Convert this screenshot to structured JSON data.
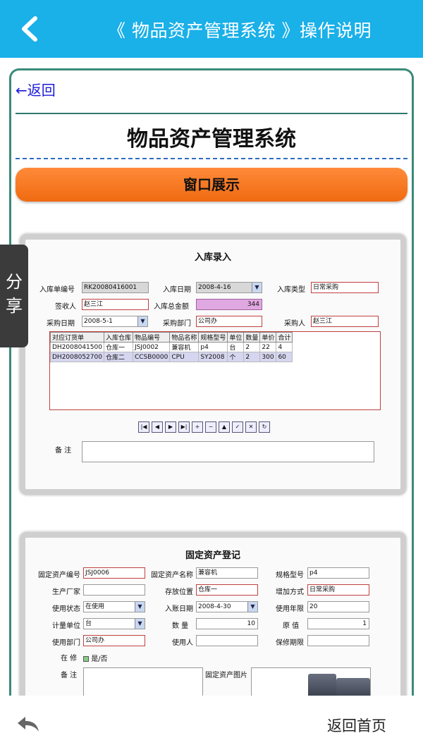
{
  "header": {
    "title": "《 物品资产管理系统 》操作说明"
  },
  "page": {
    "back_link": "←返回",
    "title": "物品资产管理系统",
    "section_banner": "窗口展示"
  },
  "share": {
    "label": "分享"
  },
  "window1": {
    "title": "入库录入",
    "fields": {
      "receipt_no_label": "入库单编号",
      "receipt_no": "RK20080416001",
      "date_label": "入库日期",
      "date": "2008-4-16",
      "type_label": "入库类型",
      "type": "日常采购",
      "receiver_label": "签收人",
      "receiver": "赵三江",
      "total_label": "入库总金额",
      "total": "344",
      "purchase_date_label": "采购日期",
      "purchase_date": "2008-5-1",
      "dept_label": "采购部门",
      "dept": "公司办",
      "buyer_label": "采购人",
      "buyer": "赵三江"
    },
    "grid": {
      "columns": [
        "对应订货单",
        "入库仓库",
        "物品编号",
        "物品名称",
        "规格型号",
        "单位",
        "数量",
        "单价",
        "合计"
      ],
      "rows": [
        [
          "DH2008041500",
          "仓库一",
          "JSJ0002",
          "兼容机",
          "p4",
          "台",
          "2",
          "22",
          "4"
        ],
        [
          "DH2008052700",
          "仓库二",
          "CCSB0000",
          "CPU",
          "SY2008",
          "个",
          "2",
          "300",
          "60"
        ]
      ]
    },
    "memo_label": "备  注"
  },
  "window2": {
    "title": "固定资产登记",
    "fields": {
      "asset_no_label": "固定资产编号",
      "asset_no": "JSJ0006",
      "asset_name_label": "固定资产名称",
      "asset_name": "兼容机",
      "spec_label": "规格型号",
      "spec": "p4",
      "maker_label": "生产厂家",
      "maker": "",
      "location_label": "存放位置",
      "location": "仓库一",
      "add_method_label": "增加方式",
      "add_method": "日常采购",
      "status_label": "使用状态",
      "status": "在使用",
      "account_date_label": "入账日期",
      "account_date": "2008-4-30",
      "years_label": "使用年限",
      "years": "20",
      "unit_label": "计量单位",
      "unit": "台",
      "qty_label": "数  量",
      "qty": "10",
      "value_label": "原  值",
      "value": "1",
      "use_dept_label": "使用部门",
      "use_dept": "公司办",
      "user_label": "使用人",
      "user": "",
      "warranty_label": "保修期限",
      "warranty": "",
      "repair_label": "在  修",
      "repair_value": "是/否",
      "memo_label": "备  注",
      "photo_label": "固定资产图片"
    }
  },
  "footer": {
    "home_label": "返回首页"
  },
  "colors": {
    "header": "#1ab0e8",
    "banner": "#f07a20",
    "card_border": "#3a8a7a"
  }
}
